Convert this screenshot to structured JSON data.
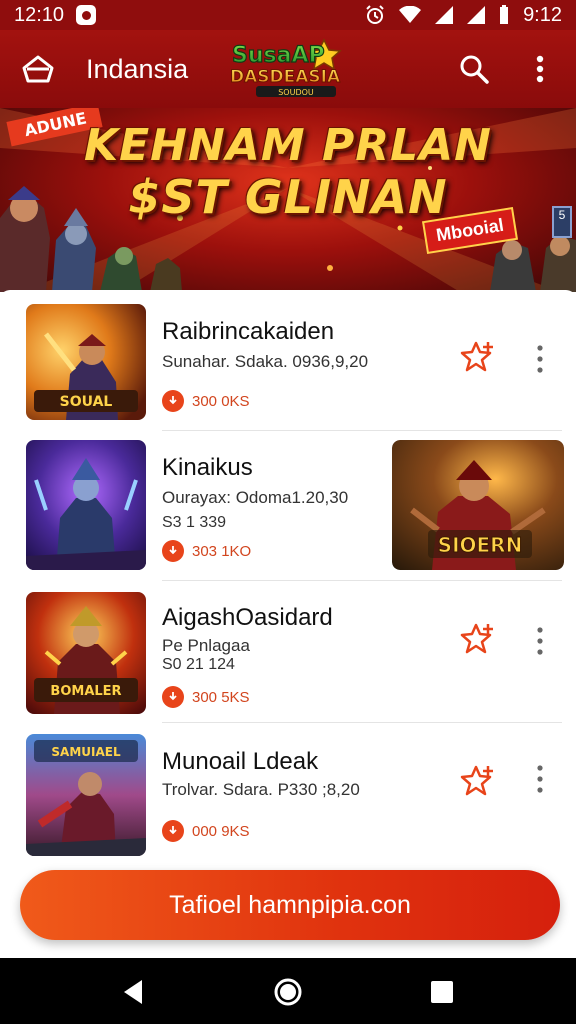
{
  "status_bar": {
    "time_left": "12:10",
    "time_right": "9:12"
  },
  "app_bar": {
    "title": "Indansia",
    "logo_line1": "SusaAP",
    "logo_line2": "DASDEASIA",
    "logo_line3": "SOUDOU"
  },
  "banner": {
    "headline_line1": "KEHNAM PRLAN",
    "headline_line2": "$ST GLINAN",
    "ribbon_left": "ADUNE",
    "mobile_tag": "Mbooial",
    "card_tag": "5"
  },
  "apps": [
    {
      "name": "Raibrincakaiden",
      "meta": "Sunahar. Sdaka. 0936,9,20",
      "meta2": "",
      "size": "300 0KS",
      "thumb_caption": "SOUAL"
    },
    {
      "name": "Kinaikus",
      "meta": "Ourayax: Odoma1.20,30",
      "meta2": "S3 1 339",
      "size": "303 1KO",
      "thumb_caption": "",
      "promo_caption": "SIOERN"
    },
    {
      "name": "AigashOasidard",
      "meta": "Pe Pnlagaa",
      "meta2": "S0 21 124",
      "size": "300 5KS",
      "thumb_caption": "BOMALER"
    },
    {
      "name": "Munoail Ldeak",
      "meta": "Trolvar. Sdara. P330 ;8,20",
      "meta2": "",
      "size": "000 9KS",
      "thumb_caption": "SAMUIAEL"
    }
  ],
  "cta": {
    "label": "Tafioel hamnpipia.con"
  },
  "colors": {
    "appbar": "#9a0f0d",
    "accent": "#e8441a",
    "cta": "#e0320e"
  },
  "icons": [
    "back-icon",
    "search-icon",
    "more-vert-icon",
    "download-icon",
    "star-add-icon",
    "kebab-icon",
    "nav-back-icon",
    "nav-home-icon",
    "nav-recent-icon"
  ]
}
